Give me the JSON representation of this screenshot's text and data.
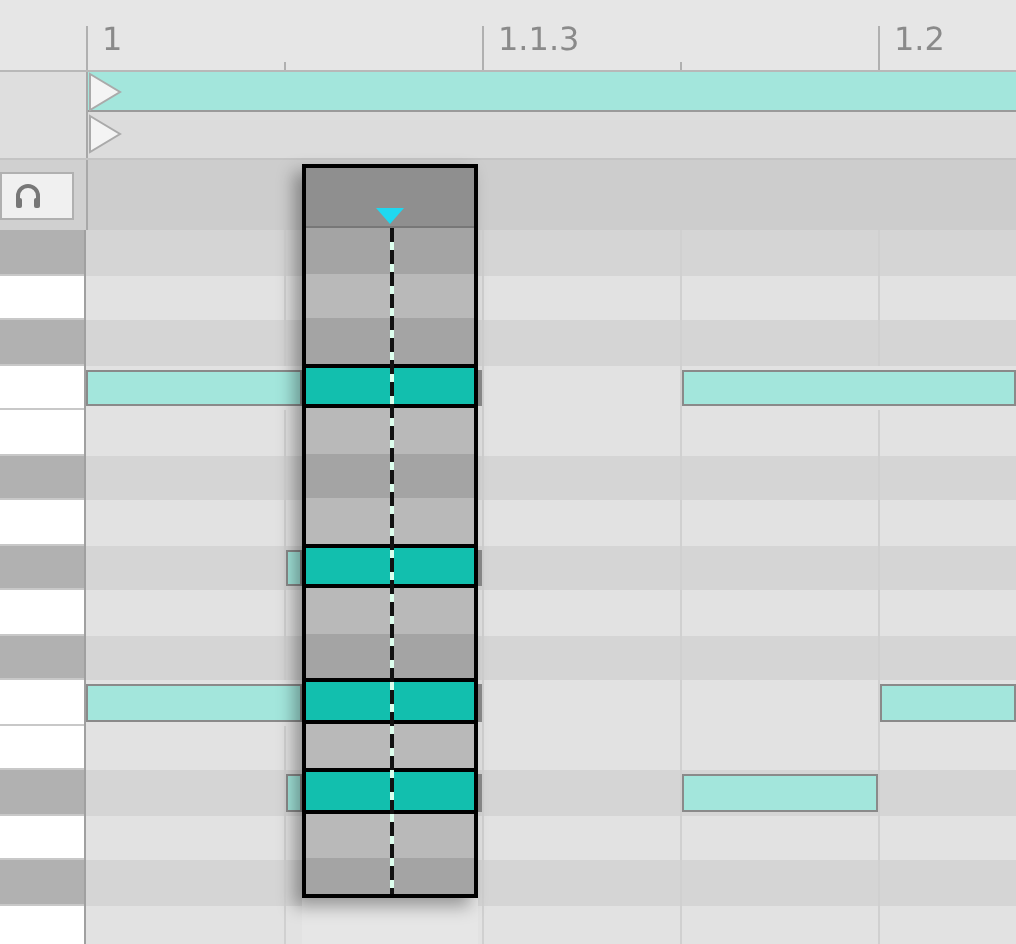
{
  "ruler": {
    "labels": [
      {
        "label": "1"
      },
      {
        "label": "1.1.3"
      },
      {
        "label": "1.2"
      }
    ]
  },
  "loop": {
    "on": true
  },
  "rows": [
    {
      "kind": "black",
      "steps": [
        false,
        false,
        false,
        false,
        false
      ]
    },
    {
      "kind": "white",
      "steps": [
        false,
        false,
        false,
        false,
        false
      ]
    },
    {
      "kind": "black",
      "steps": [
        false,
        false,
        false,
        false,
        false
      ]
    },
    {
      "kind": "white",
      "steps": [
        true,
        true,
        false,
        true,
        true
      ]
    },
    {
      "kind": "white",
      "steps": [
        false,
        false,
        false,
        false,
        false
      ]
    },
    {
      "kind": "black",
      "steps": [
        false,
        false,
        false,
        false,
        false
      ]
    },
    {
      "kind": "white",
      "steps": [
        false,
        false,
        false,
        false,
        false
      ]
    },
    {
      "kind": "black",
      "steps": [
        false,
        true,
        false,
        false,
        false
      ]
    },
    {
      "kind": "white",
      "steps": [
        false,
        false,
        false,
        false,
        false
      ]
    },
    {
      "kind": "black",
      "steps": [
        false,
        false,
        false,
        false,
        false
      ]
    },
    {
      "kind": "white",
      "steps": [
        true,
        true,
        false,
        false,
        true
      ]
    },
    {
      "kind": "white",
      "steps": [
        false,
        false,
        false,
        false,
        false
      ]
    },
    {
      "kind": "black",
      "steps": [
        false,
        true,
        false,
        true,
        false
      ]
    },
    {
      "kind": "white",
      "steps": [
        false,
        false,
        false,
        false,
        false
      ]
    },
    {
      "kind": "black",
      "steps": [
        false,
        false,
        false,
        false,
        false
      ]
    },
    {
      "kind": "white",
      "steps": [
        false,
        false,
        false,
        false,
        false
      ]
    }
  ]
}
